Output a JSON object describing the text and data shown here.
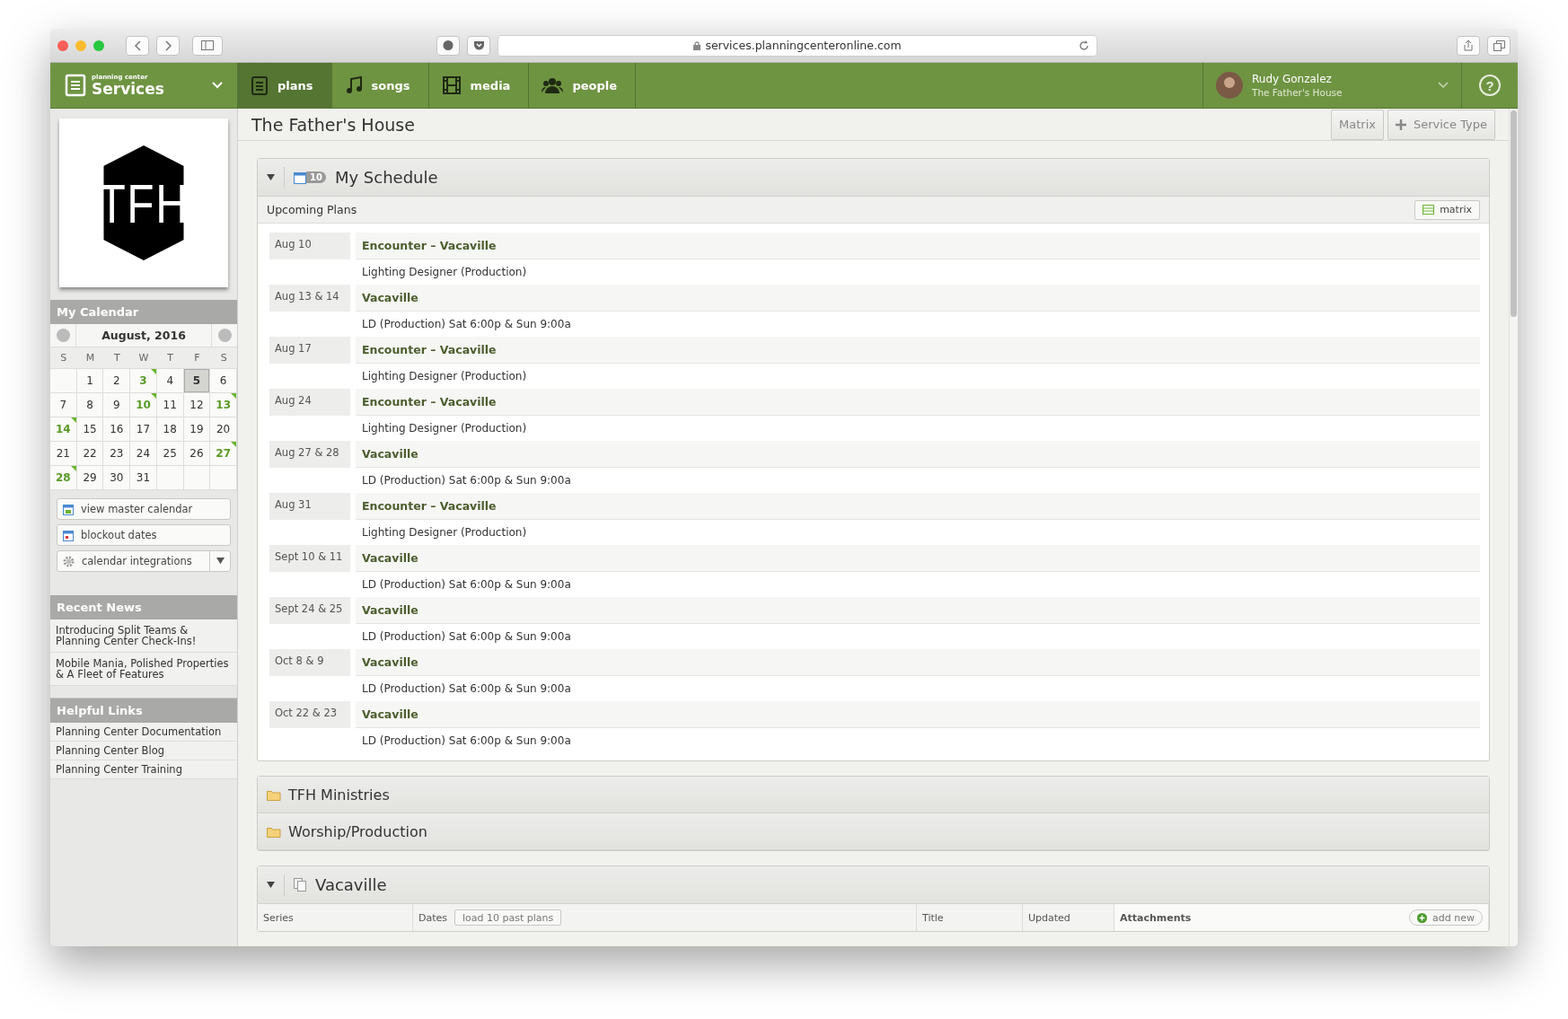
{
  "browser": {
    "url": "services.planningcenteronline.com"
  },
  "nav": {
    "brand_small": "planning center",
    "brand": "Services",
    "tabs": [
      {
        "label": "plans",
        "kind": "clipboard",
        "selected": true
      },
      {
        "label": "songs",
        "kind": "music",
        "selected": false
      },
      {
        "label": "media",
        "kind": "film",
        "selected": false
      },
      {
        "label": "people",
        "kind": "people",
        "selected": false
      }
    ],
    "user": {
      "name": "Rudy Gonzalez",
      "org": "The Father's House"
    },
    "help": "?"
  },
  "sidebar": {
    "logo_text": "TFH",
    "calendar": {
      "title": "My Calendar",
      "month": "August, 2016",
      "weekdays": [
        "S",
        "M",
        "T",
        "W",
        "T",
        "F",
        "S"
      ],
      "days": [
        {
          "kind": "blank"
        },
        {
          "kind": "day",
          "day": "1",
          "event": false,
          "today": false
        },
        {
          "kind": "day",
          "day": "2",
          "event": false,
          "today": false
        },
        {
          "kind": "day",
          "day": "3",
          "event": true,
          "today": false
        },
        {
          "kind": "day",
          "day": "4",
          "event": false,
          "today": false
        },
        {
          "kind": "day",
          "day": "5",
          "event": false,
          "today": true
        },
        {
          "kind": "day",
          "day": "6",
          "event": false,
          "today": false
        },
        {
          "kind": "day",
          "day": "7",
          "event": false,
          "today": false
        },
        {
          "kind": "day",
          "day": "8",
          "event": false,
          "today": false
        },
        {
          "kind": "day",
          "day": "9",
          "event": false,
          "today": false
        },
        {
          "kind": "day",
          "day": "10",
          "event": true,
          "today": false
        },
        {
          "kind": "day",
          "day": "11",
          "event": false,
          "today": false
        },
        {
          "kind": "day",
          "day": "12",
          "event": false,
          "today": false
        },
        {
          "kind": "day",
          "day": "13",
          "event": true,
          "today": false
        },
        {
          "kind": "day",
          "day": "14",
          "event": true,
          "today": false
        },
        {
          "kind": "day",
          "day": "15",
          "event": false,
          "today": false
        },
        {
          "kind": "day",
          "day": "16",
          "event": false,
          "today": false
        },
        {
          "kind": "day",
          "day": "17",
          "event": false,
          "today": false
        },
        {
          "kind": "day",
          "day": "18",
          "event": false,
          "today": false
        },
        {
          "kind": "day",
          "day": "19",
          "event": false,
          "today": false
        },
        {
          "kind": "day",
          "day": "20",
          "event": false,
          "today": false
        },
        {
          "kind": "day",
          "day": "21",
          "event": false,
          "today": false
        },
        {
          "kind": "day",
          "day": "22",
          "event": false,
          "today": false
        },
        {
          "kind": "day",
          "day": "23",
          "event": false,
          "today": false
        },
        {
          "kind": "day",
          "day": "24",
          "event": false,
          "today": false
        },
        {
          "kind": "day",
          "day": "25",
          "event": false,
          "today": false
        },
        {
          "kind": "day",
          "day": "26",
          "event": false,
          "today": false
        },
        {
          "kind": "day",
          "day": "27",
          "event": true,
          "today": false
        },
        {
          "kind": "day",
          "day": "28",
          "event": true,
          "today": false
        },
        {
          "kind": "day",
          "day": "29",
          "event": false,
          "today": false
        },
        {
          "kind": "day",
          "day": "30",
          "event": false,
          "today": false
        },
        {
          "kind": "day",
          "day": "31",
          "event": false,
          "today": false
        },
        {
          "kind": "blank"
        },
        {
          "kind": "blank"
        },
        {
          "kind": "blank"
        }
      ],
      "buttons": [
        {
          "label": "view master calendar",
          "kind": "calendar"
        },
        {
          "label": "blockout dates",
          "kind": "blockout"
        },
        {
          "label": "calendar integrations",
          "kind": "gear",
          "dropdown": true
        }
      ]
    },
    "recent_news": {
      "title": "Recent News",
      "items": [
        "Introducing Split Teams & Planning Center Check-Ins!",
        "Mobile Mania, Polished Properties & A Fleet of Features"
      ]
    },
    "helpful_links": {
      "title": "Helpful Links",
      "items": [
        "Planning Center Documentation",
        "Planning Center Blog",
        "Planning Center Training"
      ]
    }
  },
  "header": {
    "title": "The Father's House",
    "buttons": [
      "Matrix",
      "Service Type"
    ]
  },
  "schedule": {
    "title": "My Schedule",
    "badge": "10",
    "expanded": true,
    "subtitle": "Upcoming Plans",
    "matrix_button": "matrix",
    "plans": [
      {
        "date": "Aug 10",
        "title": "Encounter – Vacaville",
        "role": "Lighting Designer (Production)"
      },
      {
        "date": "Aug 13 & 14",
        "title": "Vacaville",
        "role": "LD (Production) Sat 6:00p & Sun 9:00a"
      },
      {
        "date": "Aug 17",
        "title": "Encounter – Vacaville",
        "role": "Lighting Designer (Production)"
      },
      {
        "date": "Aug 24",
        "title": "Encounter – Vacaville",
        "role": "Lighting Designer (Production)"
      },
      {
        "date": "Aug 27 & 28",
        "title": "Vacaville",
        "role": "LD (Production) Sat 6:00p & Sun 9:00a"
      },
      {
        "date": "Aug 31",
        "title": "Encounter – Vacaville",
        "role": "Lighting Designer (Production)"
      },
      {
        "date": "Sept 10 & 11",
        "title": "Vacaville",
        "role": "LD (Production) Sat 6:00p & Sun 9:00a"
      },
      {
        "date": "Sept 24 & 25",
        "title": "Vacaville",
        "role": "LD (Production) Sat 6:00p & Sun 9:00a"
      },
      {
        "date": "Oct 8 & 9",
        "title": "Vacaville",
        "role": "LD (Production) Sat 6:00p & Sun 9:00a"
      },
      {
        "date": "Oct 22 & 23",
        "title": "Vacaville",
        "role": "LD (Production) Sat 6:00p & Sun 9:00a"
      }
    ]
  },
  "folders": [
    "TFH Ministries",
    "Worship/Production"
  ],
  "service_type": {
    "title": "Vacaville",
    "expanded": true,
    "columns": [
      {
        "label": "Series"
      },
      {
        "label": "Dates",
        "action": "load 10 past plans"
      },
      {
        "label": "Title"
      },
      {
        "label": "Updated"
      },
      {
        "label": "Attachments",
        "action": "add new"
      }
    ]
  }
}
